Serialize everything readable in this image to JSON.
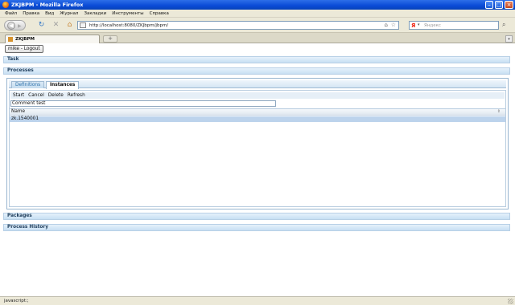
{
  "window": {
    "title": "ZKJBPM - Mozilla Firefox"
  },
  "menu": [
    "Файл",
    "Правка",
    "Вид",
    "Журнал",
    "Закладки",
    "Инструменты",
    "Справка"
  ],
  "nav": {
    "url": "http://localhost:8080/ZKJbpm/jbpm/",
    "search_placeholder": "Яндекс"
  },
  "tab": {
    "title": "ZKJBPM",
    "new_tab": "+"
  },
  "page": {
    "logout_label": "mike - Logout",
    "sections": {
      "task": "Task",
      "processes": "Processes",
      "packages": "Packages",
      "history": "Process History"
    },
    "subtabs": {
      "definitions": "Definitions",
      "instances": "Instances"
    },
    "toolbar": {
      "start": "Start",
      "cancel": "Cancel",
      "delete": "Delete",
      "refresh": "Refresh"
    },
    "comment_value": "Comment test",
    "grid": {
      "column": "Name",
      "rows": [
        "zk.1540001"
      ]
    }
  },
  "status": {
    "text": "javascript:;"
  },
  "colors": {
    "titlebar": "#0a4bd6",
    "accordion": "#c7dff3",
    "selected_row": "#bcd3ec"
  },
  "icons": [
    "firefox-icon",
    "back-arrow-icon",
    "reload-icon",
    "stop-icon",
    "home-icon",
    "star-icon",
    "search-icon"
  ]
}
